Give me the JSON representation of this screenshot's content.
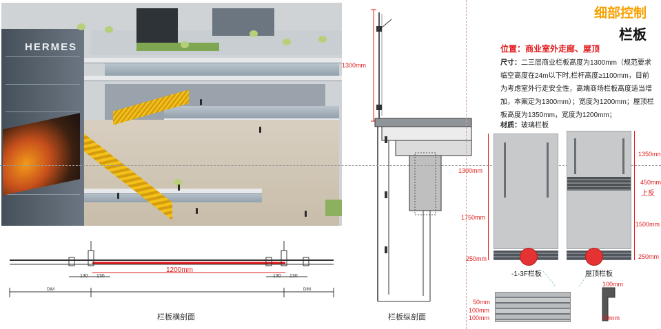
{
  "header": {
    "title": "细部控制",
    "subtitle": "栏板"
  },
  "spec": {
    "position": "位置：商业室外走廊、屋顶",
    "size_label": "尺寸：",
    "size_text": "二三层商业栏板高度为1300mm（规范要求临空高度在24m以下时,栏杆高度≥1100mm，目前为考虑室外行走安全性，高端商场栏板高度适当增加，本案定为1300mm）；宽度为1200mm；屋顶栏板高度为1350mm，宽度为1200mm；",
    "material_label": "材质：",
    "material_text": "玻璃栏板"
  },
  "rendering": {
    "brand_sign": "HERMES"
  },
  "horizontal_section": {
    "width_dim": "1200mm",
    "small_dim_1": "130",
    "small_dim_2": "130",
    "small_dim_3": "130",
    "small_dim_4": "130",
    "dim_left": "DIM",
    "dim_right": "DIM",
    "caption": "栏板横剖面"
  },
  "vertical_section": {
    "height_dim": "1300mm",
    "caption": "栏板纵剖面"
  },
  "elevations": {
    "left_dims": [
      "1300mm",
      "1750mm",
      "250mm"
    ],
    "right_dims": [
      "1350mm",
      "450mm",
      "上反",
      "1500mm",
      "250mm"
    ],
    "left_caption": "-1-3F栏板",
    "right_caption": "屋顶栏板",
    "detail_dims": [
      "50mm",
      "100mm",
      "100mm"
    ],
    "profile_dims": [
      "100mm",
      "50mm"
    ]
  },
  "colors": {
    "accent_orange": "#f6a100",
    "accent_red": "#e21b1b",
    "glass_gray": "#c7c9cb"
  }
}
